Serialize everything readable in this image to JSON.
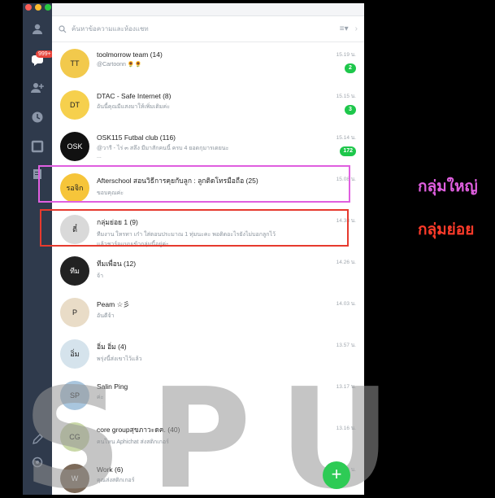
{
  "colors": {
    "background": "#000000",
    "sidebar": "#2f3a4c",
    "unread_badge": "#1ec74b",
    "highlight_large": "#e05fe0",
    "highlight_sub": "#e63a2e",
    "fab": "#2ecb55"
  },
  "sidebar": {
    "notification_badge": "999+",
    "icons": [
      "person-icon",
      "chat-icon",
      "add-friend-icon",
      "clock-icon",
      "square-icon",
      "note-icon",
      "pen-icon",
      "gear-icon"
    ]
  },
  "search": {
    "placeholder": "ค้นหาข้อความและห้องแชท"
  },
  "chats": [
    {
      "name": "toolmorrow team (14)",
      "preview": "@Cartoonn 🌻🌻",
      "preview2": "",
      "time": "15.19 น.",
      "unread": "2",
      "avatar": "TT"
    },
    {
      "name": "DTAC - Safe Internet (8)",
      "preview": "อันนี้คุณมีแสงมาให้เพิ่มเติมค่ะ",
      "preview2": "",
      "time": "15.15 น.",
      "unread": "3",
      "avatar": "DT"
    },
    {
      "name": "OSK115 Futbal club (116)",
      "preview": "@วารี - ไร่ ๓ สลึง มีมาสักคนนี้ ครบ 4 ยอดกุมารเดยนะ",
      "preview2": "...",
      "time": "15.14 น.",
      "unread": "172",
      "avatar": "OSK"
    },
    {
      "name": "Afterschool สอนวิธีการคุยกับลูก : ลูกติดโทรมือถือ (25)",
      "preview": "ขอบคุณค่ะ",
      "preview2": "",
      "time": "15.08 น.",
      "unread": "",
      "avatar": "รอจิก"
    },
    {
      "name": "กลุ่มย่อย 1 (9)",
      "preview": "ทีมงาน ใหรทา เก๋า ใส่ตอนประมาณ 1 ทุ่มนะคะ  พอติดอะไรยังไม่บอกลูกไว้",
      "preview2": "แล้วชาร์จแนบเข้ากลุ่มนี้อยู่ค่ะ",
      "time": "14.38 น.",
      "unread": "",
      "avatar": "ตี๋"
    },
    {
      "name": "ทีมเพื่อน (12)",
      "preview": "จ้า",
      "preview2": "",
      "time": "14.26 น.",
      "unread": "",
      "avatar": "ทีม"
    },
    {
      "name": "Peam ☆彡",
      "preview": "อันดีจ้า",
      "preview2": "",
      "time": "14.03 น.",
      "unread": "",
      "avatar": "P"
    },
    {
      "name": "อิ่ม อิ่ม (4)",
      "preview": "พรุ่งนี้ส่งเขาไว้แล้ว",
      "preview2": "",
      "time": "13.57 น.",
      "unread": "",
      "avatar": "อิ่ม"
    },
    {
      "name": "Salin Ping",
      "preview": "ค่ะ",
      "preview2": "",
      "time": "13.17 น.",
      "unread": "",
      "avatar": "SP"
    },
    {
      "name": "core groupสุขภาวะดค. (40)",
      "preview": "คนไหน Aphichat ส่งสติกเกอร์",
      "preview2": "",
      "time": "13.16 น.",
      "unread": "",
      "avatar": "CG"
    },
    {
      "name": "Work (6)",
      "preview": "คุณส่งสติกเกอร์",
      "preview2": "",
      "time": "13.03 น.",
      "unread": "",
      "avatar": "W"
    }
  ],
  "annotations": {
    "large_group": "กลุ่มใหญ่",
    "sub_group": "กลุ่มย่อย"
  },
  "fab": {
    "label": "+"
  },
  "watermark": "SPU"
}
